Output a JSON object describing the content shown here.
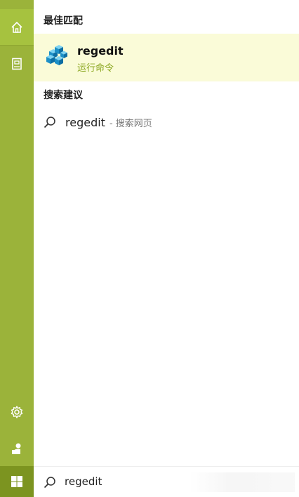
{
  "rail": {
    "home_icon": "home-icon",
    "doc_icon": "document-icon",
    "settings_icon": "gear-icon",
    "user_icon": "user-icon",
    "start_icon": "windows-start-icon",
    "accent": "#9bb33a"
  },
  "best_match": {
    "heading": "最佳匹配",
    "app_name": "regedit",
    "app_subtitle": "运行命令",
    "icon": "registry-editor-icon"
  },
  "suggestions": {
    "heading": "搜索建议",
    "items": [
      {
        "query": "regedit",
        "hint": "- 搜索网页",
        "icon": "search-icon"
      }
    ]
  },
  "search": {
    "value": "regedit",
    "icon": "search-icon"
  }
}
